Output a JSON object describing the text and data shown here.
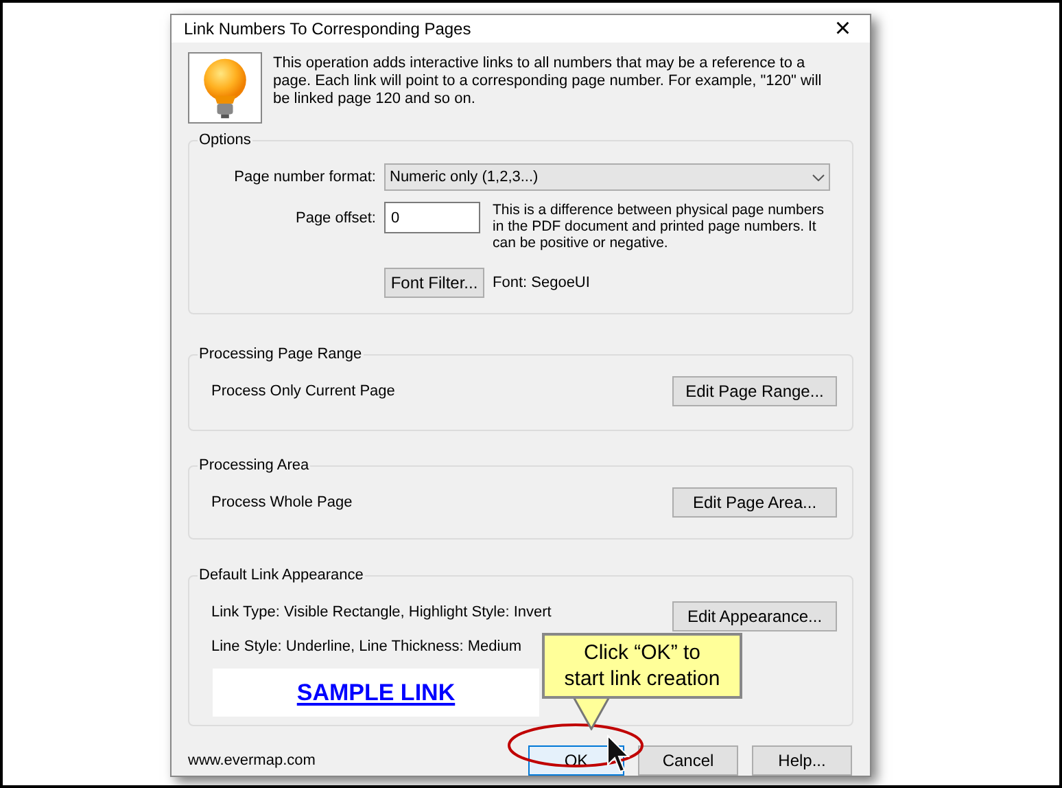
{
  "window": {
    "title": "Link Numbers To Corresponding Pages",
    "close": "×"
  },
  "description": "This operation adds interactive links to all numbers that may be a reference to a page. Each link will point to a corresponding page number. For example, \"120\" will be linked page 120 and so on.",
  "options": {
    "title": "Options",
    "page_number_format": {
      "label": "Page number format:",
      "value": "Numeric only (1,2,3...)"
    },
    "page_offset": {
      "label": "Page offset:",
      "value": "0",
      "hint": "This is a difference between physical page numbers in the PDF document and printed page numbers. It can be positive or negative."
    },
    "font_filter_button": "Font Filter...",
    "font_label": "Font: SegoeUI"
  },
  "groups": [
    {
      "title": "Processing Page Range",
      "text": "Process Only Current Page",
      "button": "Edit Page Range..."
    },
    {
      "title": "Processing Area",
      "text": "Process Whole Page",
      "button": "Edit Page Area..."
    }
  ],
  "appearance": {
    "title": "Default Link Appearance",
    "lines": [
      "Link Type: Visible Rectangle, Highlight Style: Invert",
      "Line Style: Underline, Line Thickness: Medium"
    ],
    "button": "Edit Appearance...",
    "sample": "SAMPLE LINK"
  },
  "footer": {
    "link": "www.evermap.com",
    "buttons": [
      {
        "label": "OK",
        "kind": "default"
      },
      {
        "label": "Cancel",
        "kind": "normal"
      },
      {
        "label": "Help...",
        "kind": "normal"
      }
    ]
  },
  "callout": {
    "lines": [
      "Click “OK” to",
      "start link creation"
    ]
  }
}
